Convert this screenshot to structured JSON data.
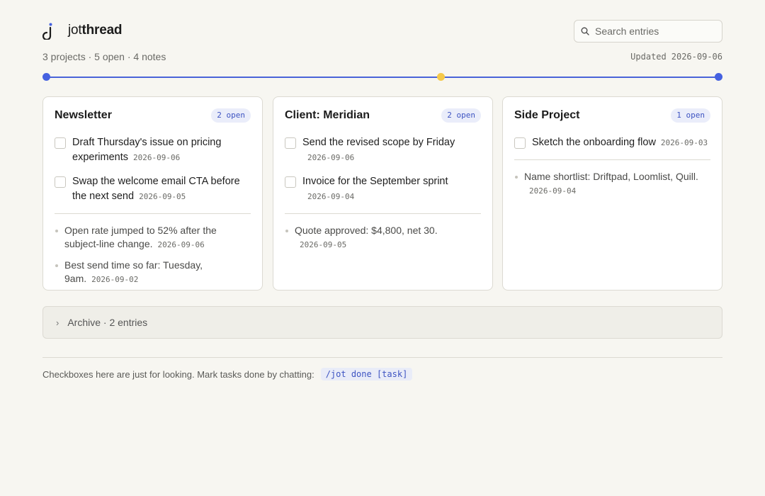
{
  "header": {
    "brand_light": "jot",
    "brand_bold": "thread",
    "search_placeholder": "Search entries"
  },
  "summary": {
    "stats": "3 projects · 5 open · 4 notes",
    "updated_label": "Updated",
    "updated_date": "2026-09-06"
  },
  "colors": {
    "accent": "#4561e0",
    "timeline_marker": "#f5c94a",
    "background": "#f7f6f1"
  },
  "projects": [
    {
      "title": "Newsletter",
      "badge": "2 open",
      "tasks": [
        {
          "text": "Draft Thursday's issue on pricing experiments",
          "date": "2026-09-06"
        },
        {
          "text": "Swap the welcome email CTA before the next send",
          "date": "2026-09-05"
        }
      ],
      "notes": [
        {
          "text": "Open rate jumped to 52% after the subject-line change.",
          "date": "2026-09-06"
        },
        {
          "text": "Best send time so far: Tuesday, 9am.",
          "date": "2026-09-02"
        }
      ]
    },
    {
      "title": "Client: Meridian",
      "badge": "2 open",
      "tasks": [
        {
          "text": "Send the revised scope by Friday",
          "date": "2026-09-06"
        },
        {
          "text": "Invoice for the September sprint",
          "date": "2026-09-04"
        }
      ],
      "notes": [
        {
          "text": "Quote approved: $4,800, net 30.",
          "date": "2026-09-05"
        }
      ]
    },
    {
      "title": "Side Project",
      "badge": "1 open",
      "tasks": [
        {
          "text": "Sketch the onboarding flow",
          "date": "2026-09-03"
        }
      ],
      "notes": [
        {
          "text": "Name shortlist: Driftpad, Loomlist, Quill.",
          "date": "2026-09-04"
        }
      ]
    }
  ],
  "archive": {
    "label": "Archive · 2 entries"
  },
  "footer": {
    "text": "Checkboxes here are just for looking. Mark tasks done by chatting:",
    "command": "/jot done [task]"
  }
}
